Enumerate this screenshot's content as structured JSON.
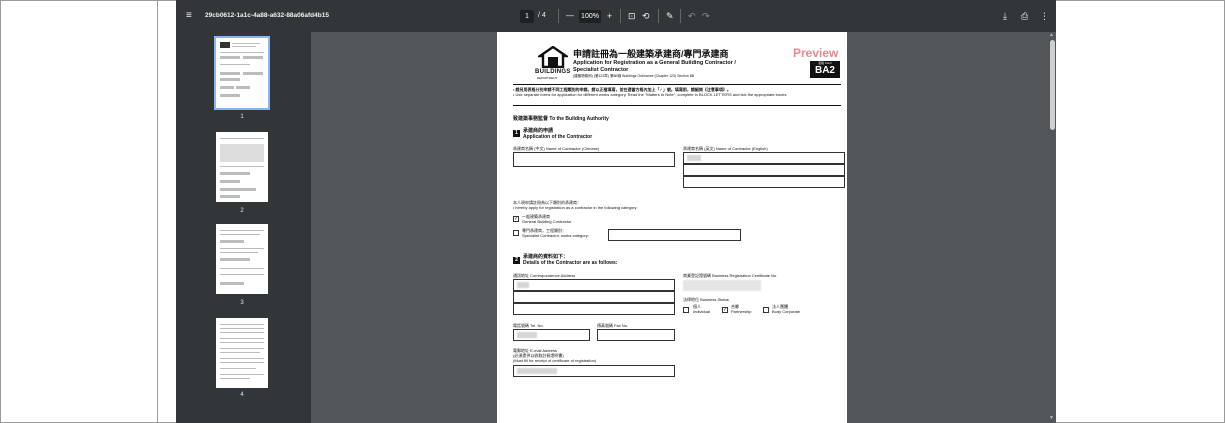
{
  "toolbar": {
    "menu_icon": "hamburger-icon",
    "file_name": "29cb0612-1a1c-4a88-a632-88a06afd4b15",
    "current_page": "1",
    "page_total": "/ 4",
    "zoom_minus": "—",
    "zoom": "100%",
    "zoom_plus": "+",
    "fit_icon": "⊡",
    "rotate_icon": "⟲",
    "draw_icon": "✎",
    "undo_icon": "↶",
    "redo_icon": "↷",
    "download_icon": "⤓",
    "print_icon": "⎙",
    "more_icon": "⋮"
  },
  "thumbnails": [
    {
      "label": "1"
    },
    {
      "label": "2"
    },
    {
      "label": "3"
    },
    {
      "label": "4"
    }
  ],
  "doc": {
    "title_cn": "申請註冊為一般建築承建商/專門承建商",
    "title_en1": "Application for Registration as a General Building Contractor /",
    "title_en2": "Specialist Contractor",
    "ordinance": "(建築物條例) (第123章) 第8B條   Buildings Ordinance (Chapter 123) Section 8B",
    "logo_text": "BUILDINGS",
    "logo_sub": "DEPARTMENT",
    "watermark": "Preview",
    "form_small": "表格 Form",
    "form_code": "BA2",
    "note_cn": "• 請另用表格分別申請不同工程類別的申請。請以正楷填寫，並在適當方格內加上「✓」號。填寫前，請細閱《注意事項》。",
    "note_en": "• Use separate forms for application for different works category. Read the \"Matters to Note\", complete in BLOCK LETTERS and tick the appropriate boxes.",
    "to_authority": "致建築事務監督  To the Building Authority",
    "s1_no": "1",
    "s1_cn": "承建商的申請",
    "s1_en": "Application of the Contractor",
    "name_cn_label": "承建商名稱 (中文)  Name of Contractor (Chinese)",
    "name_en_label": "承建商名稱 (英文)  Name of Contractor (English)",
    "apply_cn": "本人現申請註冊為以下類別的承建商：",
    "apply_en": "I hereby apply for registration as a contractor in the following category:",
    "opt1_cn": "一般建築承建商",
    "opt1_en": "General Building Contractor",
    "opt1_check": "✓",
    "opt2_cn": "專門承建商，工程類別：",
    "opt2_en": "Specialist Contractor, works category:",
    "s2_no": "2",
    "s2_cn": "承建商的資料如下：",
    "s2_en": "Details of the Contractor are as follows:",
    "address_label": "通訊地址  Correspondence Address",
    "brc_label": "商業登記證號碼  Business Registration Certificate No.",
    "status_label": "法律地位  Business Status",
    "status_opt1_cn": "個人",
    "status_opt1_en": "Individual",
    "status_opt2_cn": "合夥",
    "status_opt2_en": "Partnership",
    "status_opt2_check": "✓",
    "status_opt3_cn": "法人團體",
    "status_opt3_en": "Body Corporate",
    "tel_label": "電話號碼  Tel. No.",
    "fax_label": "傳真號碼  Fax No.",
    "email_label1": "電郵地址  E-mail Address",
    "email_label2": "(必須提供以收取註冊證明書)",
    "email_label3": "(Must fill for receipt of certificate of registration)"
  }
}
